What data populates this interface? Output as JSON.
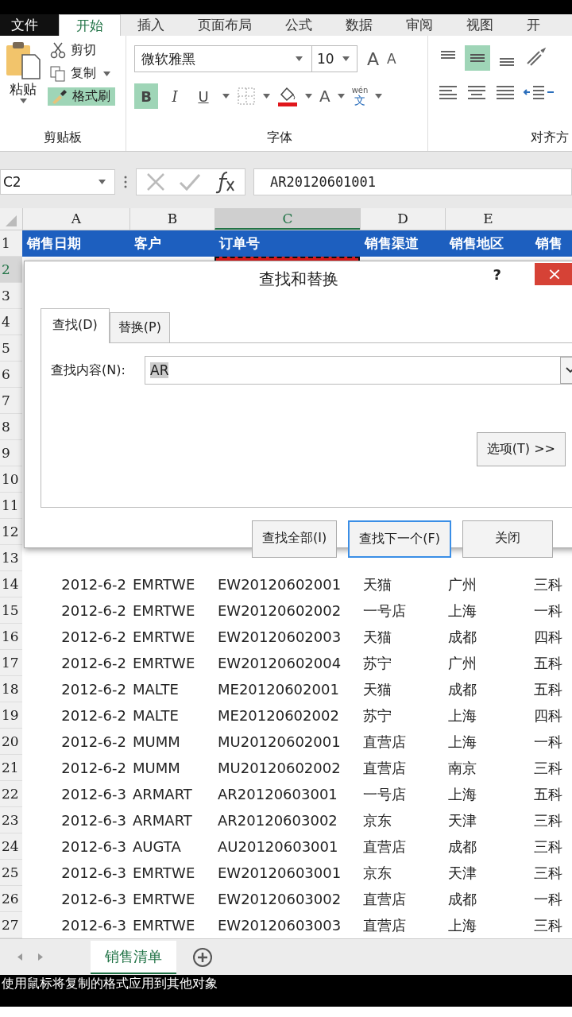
{
  "ribbon_tabs": [
    {
      "label": "文件",
      "kind": "file",
      "selected": false
    },
    {
      "label": "开始",
      "kind": "tab",
      "selected": true
    },
    {
      "label": "插入",
      "kind": "tab",
      "selected": false
    },
    {
      "label": "页面布局",
      "kind": "tab",
      "selected": false
    },
    {
      "label": "公式",
      "kind": "tab",
      "selected": false
    },
    {
      "label": "数据",
      "kind": "tab",
      "selected": false
    },
    {
      "label": "审阅",
      "kind": "tab",
      "selected": false
    },
    {
      "label": "视图",
      "kind": "tab",
      "selected": false
    },
    {
      "label": "开",
      "kind": "tab",
      "selected": false
    }
  ],
  "clipboard": {
    "paste": "粘贴",
    "cut": "剪切",
    "copy": "复制",
    "format_painter": {
      "label": "格式刷",
      "on": true
    },
    "group_label": "剪贴板"
  },
  "font": {
    "name": "微软雅黑",
    "size": "10",
    "grow": "A",
    "shrink": "A",
    "styles": [
      {
        "label": "B",
        "kind": "bold",
        "on": true
      },
      {
        "label": "I",
        "kind": "italic",
        "on": false
      },
      {
        "label": "U",
        "kind": "underline",
        "on": false
      }
    ],
    "font_color": "A",
    "phonetic_top": "wén",
    "phonetic_bottom": "文",
    "group_label": "字体"
  },
  "alignment": {
    "middle_align_on": true,
    "group_label": "对齐方"
  },
  "formula_bar": {
    "name_box": "C2",
    "value": "AR20120601001"
  },
  "columns": [
    {
      "label": "A",
      "selected": false
    },
    {
      "label": "B",
      "selected": false
    },
    {
      "label": "C",
      "selected": true
    },
    {
      "label": "D",
      "selected": false
    },
    {
      "label": "E",
      "selected": false
    }
  ],
  "rows": [
    {
      "number": "1",
      "header": true,
      "selected": false,
      "cells": [
        "销售日期",
        "客户",
        "订单号",
        "销售渠道",
        "销售地区",
        "销售"
      ]
    },
    {
      "number": "2",
      "selected": true,
      "cells": []
    },
    {
      "number": "3",
      "selected": false,
      "cells": []
    },
    {
      "number": "4",
      "selected": false,
      "cells": []
    },
    {
      "number": "5",
      "selected": false,
      "cells": []
    },
    {
      "number": "6",
      "selected": false,
      "cells": []
    },
    {
      "number": "7",
      "selected": false,
      "cells": []
    },
    {
      "number": "8",
      "selected": false,
      "cells": []
    },
    {
      "number": "9",
      "selected": false,
      "cells": []
    },
    {
      "number": "10",
      "selected": false,
      "cells": []
    },
    {
      "number": "11",
      "selected": false,
      "cells": []
    },
    {
      "number": "12",
      "selected": false,
      "cells": []
    },
    {
      "number": "13",
      "selected": false,
      "cells": []
    },
    {
      "number": "14",
      "selected": false,
      "cells": [
        "2012-6-2",
        "EMRTWE",
        "EW20120602001",
        "天猫",
        "广州",
        "三科"
      ]
    },
    {
      "number": "15",
      "selected": false,
      "cells": [
        "2012-6-2",
        "EMRTWE",
        "EW20120602002",
        "一号店",
        "上海",
        "一科"
      ]
    },
    {
      "number": "16",
      "selected": false,
      "cells": [
        "2012-6-2",
        "EMRTWE",
        "EW20120602003",
        "天猫",
        "成都",
        "四科"
      ]
    },
    {
      "number": "17",
      "selected": false,
      "cells": [
        "2012-6-2",
        "EMRTWE",
        "EW20120602004",
        "苏宁",
        "广州",
        "五科"
      ]
    },
    {
      "number": "18",
      "selected": false,
      "cells": [
        "2012-6-2",
        "MALTE",
        "ME20120602001",
        "天猫",
        "成都",
        "五科"
      ]
    },
    {
      "number": "19",
      "selected": false,
      "cells": [
        "2012-6-2",
        "MALTE",
        "ME20120602002",
        "苏宁",
        "上海",
        "四科"
      ]
    },
    {
      "number": "20",
      "selected": false,
      "cells": [
        "2012-6-2",
        "MUMM",
        "MU20120602001",
        "直营店",
        "上海",
        "一科"
      ]
    },
    {
      "number": "21",
      "selected": false,
      "cells": [
        "2012-6-2",
        "MUMM",
        "MU20120602002",
        "直营店",
        "南京",
        "三科"
      ]
    },
    {
      "number": "22",
      "selected": false,
      "cells": [
        "2012-6-3",
        "ARMART",
        "AR20120603001",
        "一号店",
        "上海",
        "五科"
      ]
    },
    {
      "number": "23",
      "selected": false,
      "cells": [
        "2012-6-3",
        "ARMART",
        "AR20120603002",
        "京东",
        "天津",
        "三科"
      ]
    },
    {
      "number": "24",
      "selected": false,
      "cells": [
        "2012-6-3",
        "AUGTA",
        "AU20120603001",
        "直营店",
        "成都",
        "三科"
      ]
    },
    {
      "number": "25",
      "selected": false,
      "cells": [
        "2012-6-3",
        "EMRTWE",
        "EW20120603001",
        "京东",
        "天津",
        "三科"
      ]
    },
    {
      "number": "26",
      "selected": false,
      "cells": [
        "2012-6-3",
        "EMRTWE",
        "EW20120603002",
        "直营店",
        "成都",
        "一科"
      ]
    },
    {
      "number": "27",
      "selected": false,
      "cells": [
        "2012-6-3",
        "EMRTWE",
        "EW20120603003",
        "直营店",
        "上海",
        "三科"
      ]
    }
  ],
  "dialog": {
    "title": "查找和替换",
    "help": "?",
    "close": "×",
    "tabs": [
      {
        "label": "查找(D)",
        "selected": true
      },
      {
        "label": "替换(P)",
        "selected": false
      }
    ],
    "find_label": "查找内容(N):",
    "find_value": "AR",
    "options_button": "选项(T) >>",
    "buttons": [
      {
        "label": "查找全部(I)",
        "default": false
      },
      {
        "label": "查找下一个(F)",
        "default": true
      },
      {
        "label": "关闭",
        "default": false
      }
    ]
  },
  "sheet_tabs": [
    {
      "label": "销售清单",
      "selected": true
    }
  ],
  "status_bar": "使用鼠标将复制的格式应用到其他对象"
}
